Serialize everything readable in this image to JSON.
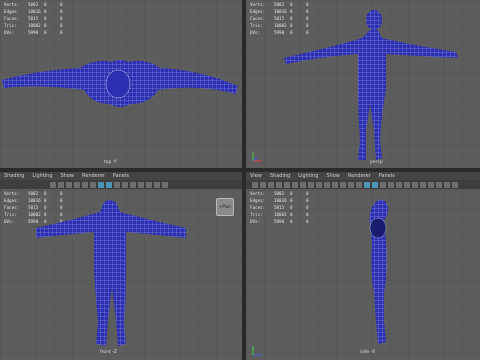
{
  "menus": [
    "View",
    "Shading",
    "Lighting",
    "Show",
    "Renderer",
    "Panels"
  ],
  "menus_bottom_left": [
    "Shading",
    "Lighting",
    "Show",
    "Renderer",
    "Panels"
  ],
  "hud_labels": [
    "Verts:",
    "Edges:",
    "Faces:",
    "Tris:",
    "UVs:"
  ],
  "top_left": {
    "values": [
      [
        "5002",
        "0",
        "0"
      ],
      [
        "10016",
        "0",
        "0"
      ],
      [
        "5015",
        "0",
        "0"
      ],
      [
        "10002",
        "0",
        "0"
      ],
      [
        "5990",
        "0",
        "0"
      ]
    ],
    "camera": "top -Y"
  },
  "top_right": {
    "values": [
      [
        "5002",
        "0",
        "0"
      ],
      [
        "10016",
        "0",
        "0"
      ],
      [
        "5015",
        "0",
        "0"
      ],
      [
        "10002",
        "0",
        "0"
      ],
      [
        "5990",
        "0",
        "0"
      ]
    ],
    "camera": "persp"
  },
  "bottom_left": {
    "values": [
      [
        "5002",
        "0",
        "0"
      ],
      [
        "10016",
        "0",
        "0"
      ],
      [
        "5015",
        "0",
        "0"
      ],
      [
        "10002",
        "0",
        "0"
      ],
      [
        "5990",
        "0",
        "0"
      ]
    ],
    "camera": "front -Z",
    "hud_button": "+Plan"
  },
  "bottom_right": {
    "values": [
      [
        "5002",
        "0",
        "0"
      ],
      [
        "10016",
        "0",
        "0"
      ],
      [
        "5015",
        "0",
        "0"
      ],
      [
        "10002",
        "0",
        "0"
      ],
      [
        "5990",
        "0",
        "0"
      ]
    ],
    "camera": "side -X"
  },
  "colors": {
    "mesh": "#2b2fb0",
    "wire": "#c9ccff",
    "bg": "#5d5d5d"
  }
}
